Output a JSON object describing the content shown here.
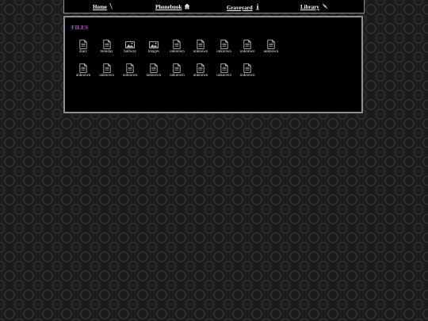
{
  "nav": {
    "items": [
      {
        "label": "Home",
        "icon": "wand-icon"
      },
      {
        "label": "Phonebook",
        "icon": "house-icon"
      },
      {
        "label": "Graveyard",
        "icon": "candle-icon"
      },
      {
        "label": "Library",
        "icon": "quill-icon"
      }
    ]
  },
  "files_panel": {
    "title": "FILES",
    "title_color": "#c04be8",
    "files": [
      {
        "name": "diary",
        "icon": "document-icon"
      },
      {
        "name": "monday",
        "icon": "document-icon"
      },
      {
        "name": "hallway",
        "icon": "image-icon"
      },
      {
        "name": "images",
        "icon": "image-icon"
      },
      {
        "name": "unknown",
        "icon": "document-icon"
      },
      {
        "name": "unknown",
        "icon": "document-icon"
      },
      {
        "name": "unknown",
        "icon": "document-icon"
      },
      {
        "name": "unknown",
        "icon": "document-icon"
      },
      {
        "name": "unknown",
        "icon": "document-icon"
      },
      {
        "name": "unknown",
        "icon": "document-icon"
      },
      {
        "name": "unknown",
        "icon": "document-icon"
      },
      {
        "name": "unknown",
        "icon": "document-icon"
      },
      {
        "name": "unknown",
        "icon": "document-icon"
      },
      {
        "name": "unknown",
        "icon": "document-icon"
      },
      {
        "name": "unknown",
        "icon": "document-icon"
      },
      {
        "name": "unknown",
        "icon": "document-icon"
      },
      {
        "name": "unknown",
        "icon": "document-icon"
      }
    ]
  }
}
